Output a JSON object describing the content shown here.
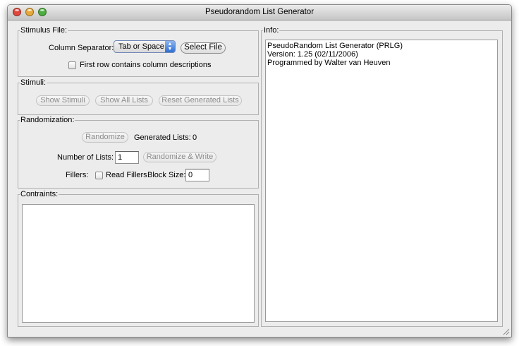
{
  "window": {
    "title": "Pseudorandom List Generator"
  },
  "stimulus_file": {
    "legend": "Stimulus File:",
    "separator_label": "Column Separator:",
    "separator_value": "Tab or Space",
    "select_file_button": "Select File",
    "first_row_checkbox_label": "First row contains column descriptions",
    "first_row_checked": false
  },
  "stimuli": {
    "legend": "Stimuli:",
    "show_stimuli_button": "Show Stimuli",
    "show_all_lists_button": "Show All Lists",
    "reset_button": "Reset Generated Lists"
  },
  "randomization": {
    "legend": "Randomization:",
    "randomize_button": "Randomize",
    "generated_lists_label": "Generated Lists:",
    "generated_lists_value": "0",
    "number_of_lists_label": "Number of Lists:",
    "number_of_lists_value": "1",
    "randomize_write_button": "Randomize & Write",
    "fillers_label": "Fillers:",
    "read_fillers_label": "Read Fillers",
    "read_fillers_checked": false,
    "block_size_label": "Block Size:",
    "block_size_value": "0"
  },
  "constraints": {
    "legend": "Contraints:"
  },
  "info": {
    "legend": "Info:",
    "lines": [
      "PseudoRandom List Generator (PRLG)",
      "Version: 1.25 (02/11/2006)",
      "Programmed by Walter van Heuven"
    ]
  },
  "colors": {
    "close": "#e0463b",
    "minimize": "#e7a93a",
    "zoom": "#4cae3f",
    "accent": "#3a78d8"
  }
}
